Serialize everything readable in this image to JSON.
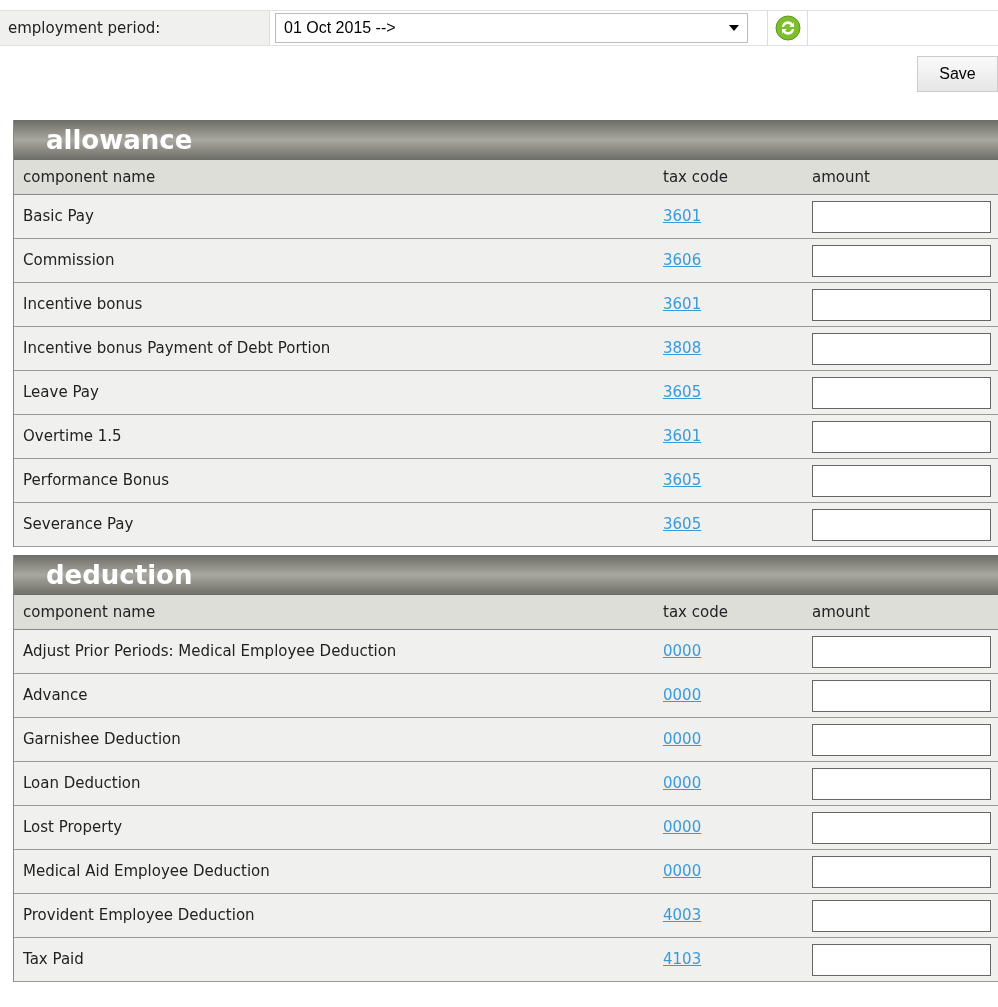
{
  "period": {
    "label": "employment period:",
    "value": "01 Oct 2015 -->"
  },
  "save_button": "Save",
  "sections": [
    {
      "title": "allowance",
      "columns": [
        "component name",
        "tax code",
        "amount"
      ],
      "rows": [
        {
          "name": "Basic Pay",
          "tax_code": "3601"
        },
        {
          "name": "Commission",
          "tax_code": "3606"
        },
        {
          "name": "Incentive bonus",
          "tax_code": "3601"
        },
        {
          "name": "Incentive bonus Payment of Debt Portion",
          "tax_code": "3808"
        },
        {
          "name": "Leave Pay",
          "tax_code": "3605"
        },
        {
          "name": "Overtime 1.5",
          "tax_code": "3601"
        },
        {
          "name": "Performance Bonus",
          "tax_code": "3605"
        },
        {
          "name": "Severance Pay",
          "tax_code": "3605"
        }
      ]
    },
    {
      "title": "deduction",
      "columns": [
        "component name",
        "tax code",
        "amount"
      ],
      "rows": [
        {
          "name": "Adjust Prior Periods: Medical Employee Deduction",
          "tax_code": "0000"
        },
        {
          "name": "Advance",
          "tax_code": "0000"
        },
        {
          "name": "Garnishee Deduction",
          "tax_code": "0000"
        },
        {
          "name": "Loan Deduction",
          "tax_code": "0000"
        },
        {
          "name": "Lost Property",
          "tax_code": "0000"
        },
        {
          "name": "Medical Aid Employee Deduction",
          "tax_code": "0000"
        },
        {
          "name": "Provident Employee Deduction",
          "tax_code": "4003"
        },
        {
          "name": "Tax Paid",
          "tax_code": "4103"
        }
      ]
    }
  ]
}
